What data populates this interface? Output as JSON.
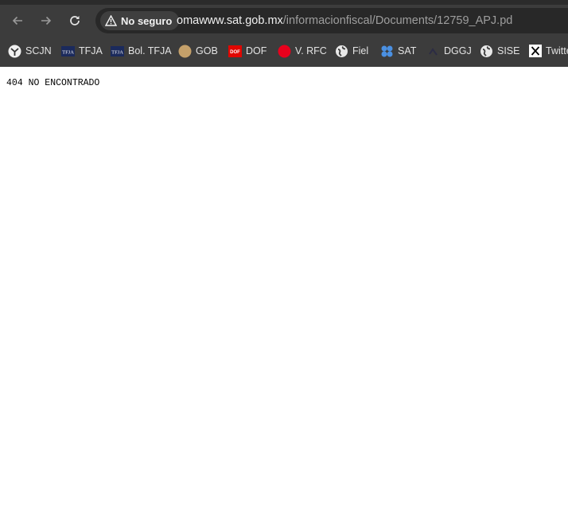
{
  "browser": {
    "security_chip": "No seguro",
    "url_host": "omawww.sat.gob.mx",
    "url_path": "/informacionfiscal/Documents/12759_APJ.pd"
  },
  "bookmarks": [
    {
      "label": "SCJN",
      "icon": "scjn-icon"
    },
    {
      "label": "TFJA",
      "icon": "tfja-icon"
    },
    {
      "label": "Bol. TFJA",
      "icon": "tfja-icon"
    },
    {
      "label": "GOB",
      "icon": "gob-icon"
    },
    {
      "label": "DOF",
      "icon": "dof-icon"
    },
    {
      "label": "V. RFC",
      "icon": "red-circle-icon"
    },
    {
      "label": "Fiel",
      "icon": "globe-icon"
    },
    {
      "label": "SAT",
      "icon": "sat-icon"
    },
    {
      "label": "DGGJ",
      "icon": "dggj-icon"
    },
    {
      "label": "SISE",
      "icon": "globe-icon"
    },
    {
      "label": "Twitte",
      "icon": "x-icon"
    }
  ],
  "page": {
    "message": "404 NO ENCONTRADO"
  },
  "colors": {
    "chrome_bg": "#3c3c3c",
    "omnibox_bg": "#282828",
    "dof_red": "#e10600",
    "rfc_red": "#e8001c",
    "sat_blue": "#4a90e2",
    "gob_tan": "#c4a06a"
  }
}
